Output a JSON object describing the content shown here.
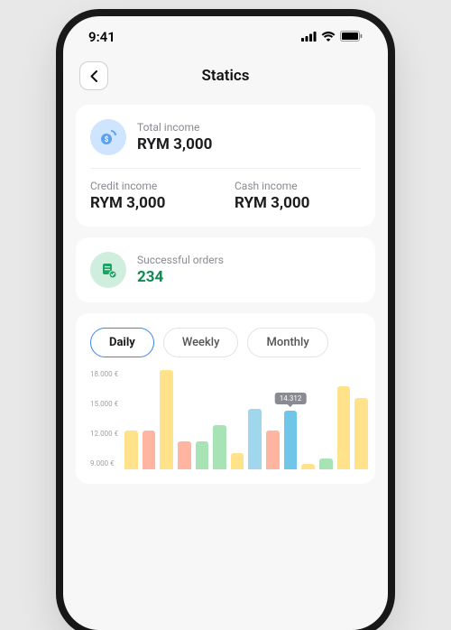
{
  "status": {
    "time": "9:41"
  },
  "header": {
    "title": "Statics"
  },
  "income": {
    "total_label": "Total income",
    "total_value": "RYM 3,000",
    "credit_label": "Credit income",
    "credit_value": "RYM 3,000",
    "cash_label": "Cash income",
    "cash_value": "RYM 3,000"
  },
  "orders": {
    "label": "Successful orders",
    "value": "234"
  },
  "tabs": {
    "daily": "Daily",
    "weekly": "Weekly",
    "monthly": "Monthly"
  },
  "chart_data": {
    "type": "bar",
    "ylabel": "",
    "xlabel": "",
    "ylim": [
      9000,
      18000
    ],
    "y_ticks": [
      "18.000 €",
      "15.000 €",
      "12.000 €",
      "9.000 €"
    ],
    "tooltip": {
      "index": 9,
      "value": "14.312"
    },
    "values": [
      12500,
      12500,
      18000,
      11500,
      11500,
      13000,
      10500,
      14500,
      12500,
      14312,
      9500,
      10000,
      16500,
      15500
    ],
    "colors": [
      "#ffe28a",
      "#ffb5a0",
      "#ffe28a",
      "#ffb5a0",
      "#a7e3b5",
      "#a7e3b5",
      "#ffe28a",
      "#a0d7ec",
      "#ffb5a0",
      "#6fc6e8",
      "#ffe28a",
      "#a7e3b5",
      "#ffe28a",
      "#ffe28a"
    ]
  }
}
